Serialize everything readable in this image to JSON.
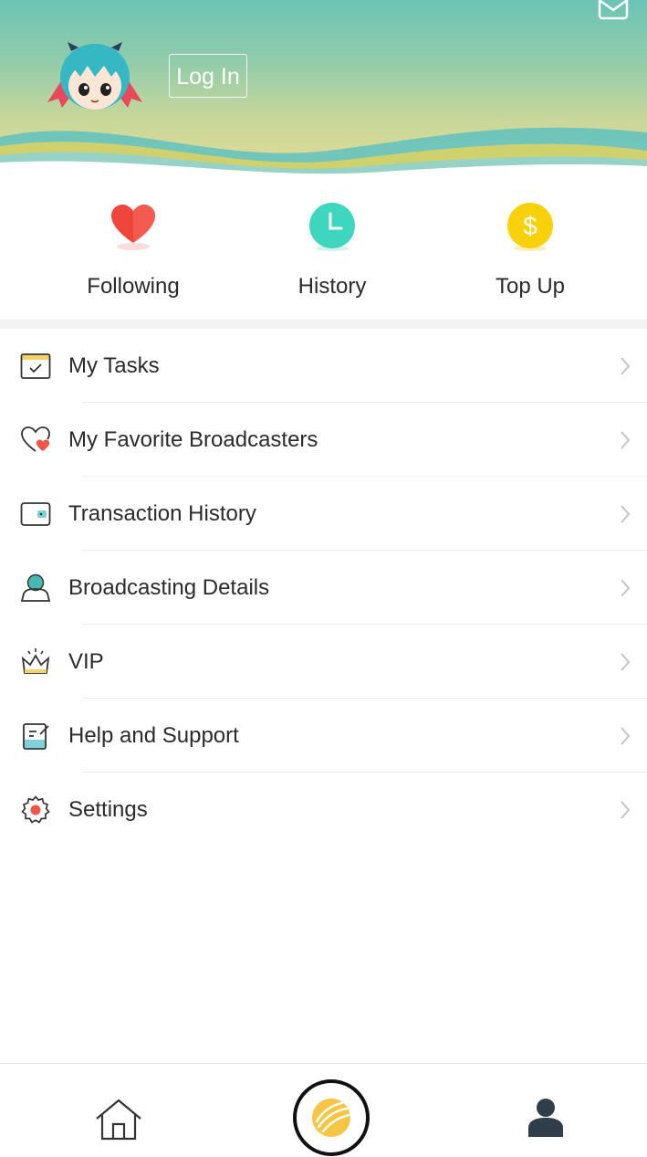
{
  "header": {
    "login_label": "Log In",
    "mail_icon": "mail-icon",
    "avatar_icon": "anime-avatar"
  },
  "quick_actions": [
    {
      "label": "Following",
      "icon": "heart-icon",
      "color": "#f0453a"
    },
    {
      "label": "History",
      "icon": "clock-icon",
      "color": "#3fd6c0"
    },
    {
      "label": "Top Up",
      "icon": "dollar-coin-icon",
      "color": "#f8d10a"
    }
  ],
  "menu": [
    {
      "label": "My Tasks",
      "icon": "tasks-icon"
    },
    {
      "label": "My Favorite Broadcasters",
      "icon": "favorite-heart-icon"
    },
    {
      "label": "Transaction History",
      "icon": "wallet-icon"
    },
    {
      "label": "Broadcasting Details",
      "icon": "broadcaster-icon"
    },
    {
      "label": "VIP",
      "icon": "crown-icon"
    },
    {
      "label": "Help and Support",
      "icon": "edit-note-icon"
    },
    {
      "label": "Settings",
      "icon": "gear-icon"
    }
  ],
  "bottom_nav": [
    {
      "name": "home",
      "icon": "home-icon"
    },
    {
      "name": "live",
      "icon": "live-stream-icon"
    },
    {
      "name": "me",
      "icon": "person-icon"
    }
  ],
  "colors": {
    "accent_teal": "#4cc2b7",
    "accent_yellow": "#f8d10a",
    "accent_red": "#f0453a"
  }
}
